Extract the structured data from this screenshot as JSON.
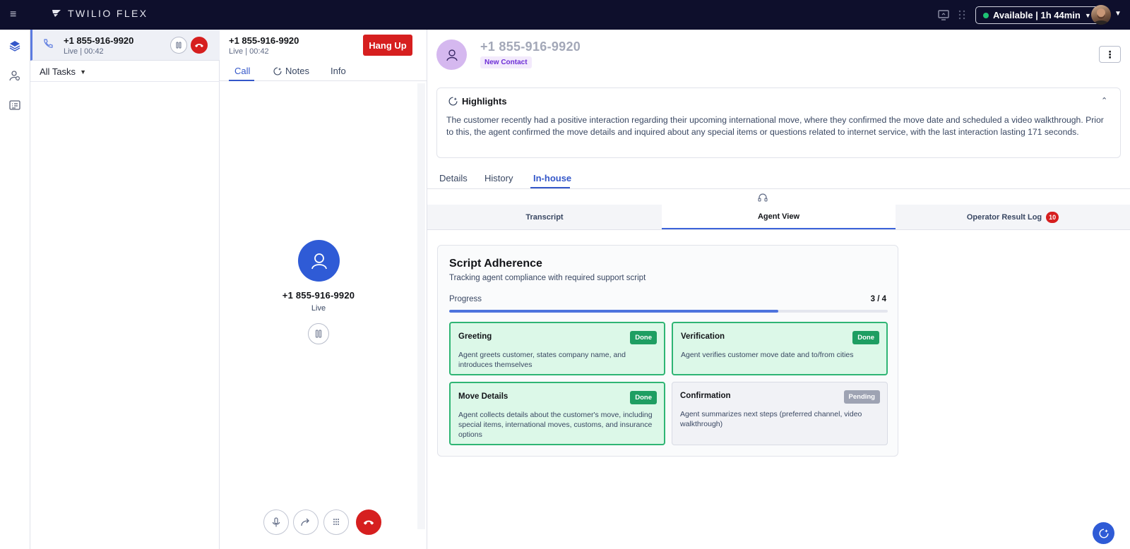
{
  "app": {
    "brand": "TWILIO FLEX"
  },
  "status": {
    "label": "Available | 1h 44min",
    "color": "#1ec274"
  },
  "task": {
    "title": "+1 855-916-9920",
    "subtitle": "Live | 00:42",
    "filter": "All Tasks"
  },
  "call_panel": {
    "title": "+1 855-916-9920",
    "subtitle": "Live | 00:42",
    "hangup_label": "Hang Up",
    "tabs": [
      {
        "label": "Call"
      },
      {
        "label": "Notes"
      },
      {
        "label": "Info"
      }
    ],
    "caller_number": "+1 855-916-9920",
    "caller_status": "Live"
  },
  "contact": {
    "name": "+1 855-916-9920",
    "badge": "New Contact"
  },
  "highlights": {
    "title": "Highlights",
    "text": "The customer recently had a positive interaction regarding their upcoming international move, where they confirmed the move date and scheduled a video walkthrough. Prior to this, the agent confirmed the move details and inquired about any special items or questions related to internet service, with the last interaction lasting 171 seconds."
  },
  "content_tabs": [
    {
      "label": "Details"
    },
    {
      "label": "History"
    },
    {
      "label": "In-house"
    }
  ],
  "sub_tabs": [
    {
      "label": "Transcript"
    },
    {
      "label": "Agent View"
    },
    {
      "label": "Operator Result Log",
      "count": "10"
    }
  ],
  "script": {
    "title": "Script Adherence",
    "subtitle": "Tracking agent compliance with required support script",
    "progress_label": "Progress",
    "progress_count": "3 / 4",
    "progress_fraction": 0.75,
    "steps": [
      {
        "title": "Greeting",
        "status": "Done",
        "desc": "Agent greets customer, states company name, and introduces themselves"
      },
      {
        "title": "Verification",
        "status": "Done",
        "desc": "Agent verifies customer move date and to/from cities"
      },
      {
        "title": "Move Details",
        "status": "Done",
        "desc": "Agent collects details about the customer's move, including special items, international moves, customs, and insurance options"
      },
      {
        "title": "Confirmation",
        "status": "Pending",
        "desc": "Agent summarizes next steps (preferred channel, video walkthrough)"
      }
    ]
  },
  "colors": {
    "accent": "#3457c9",
    "danger": "#d61f1f",
    "success": "#1e9e62",
    "topbar": "#0e0f2c"
  },
  "icons": {
    "menu": "hamburger-icon",
    "brand": "twilio-logo-icon",
    "screen": "screen-share-icon",
    "grid": "dialpad-grid-icon",
    "layers": "layers-icon",
    "teams": "teams-icon",
    "queues": "queue-stats-icon",
    "phone": "phone-icon",
    "pause": "pause-icon",
    "hangup": "hangup-icon",
    "notes": "sparkle-icon",
    "user": "user-icon",
    "mic": "microphone-icon",
    "transfer": "transfer-icon",
    "dialpad": "dialpad-icon",
    "headset": "headset-icon",
    "more": "more-vertical-icon",
    "chevron": "chevron-up-icon",
    "assistant": "assistant-icon"
  }
}
